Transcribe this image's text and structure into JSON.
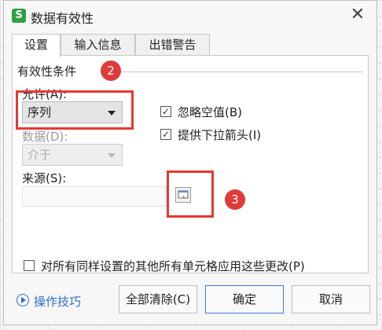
{
  "window": {
    "title": "数据有效性",
    "app_icon_letter": "S"
  },
  "tabs": [
    {
      "label": "设置",
      "active": true
    },
    {
      "label": "输入信息",
      "active": false
    },
    {
      "label": "出错警告",
      "active": false
    }
  ],
  "settings": {
    "section_title": "有效性条件",
    "allow_label": "允许(A):",
    "allow_value": "序列",
    "data_label": "数据(D):",
    "data_value": "介于",
    "source_label": "来源(S):",
    "source_value": "",
    "ignore_blank_label": "忽略空值(B)",
    "ignore_blank_checked": true,
    "dropdown_label": "提供下拉箭头(I)",
    "dropdown_checked": true,
    "apply_all_label": "对所有同样设置的其他所有单元格应用这些更改(P)",
    "apply_all_checked": false
  },
  "annotations": [
    "2",
    "3"
  ],
  "footer": {
    "tips_label": "操作技巧",
    "clear_all_label": "全部清除(C)",
    "ok_label": "确定",
    "cancel_label": "取消"
  },
  "colors": {
    "highlight": "#e53935",
    "badge": "#e03b3b",
    "link": "#2a6fd1",
    "primary_border": "#3b7ad9",
    "app_icon": "#2ea043"
  }
}
